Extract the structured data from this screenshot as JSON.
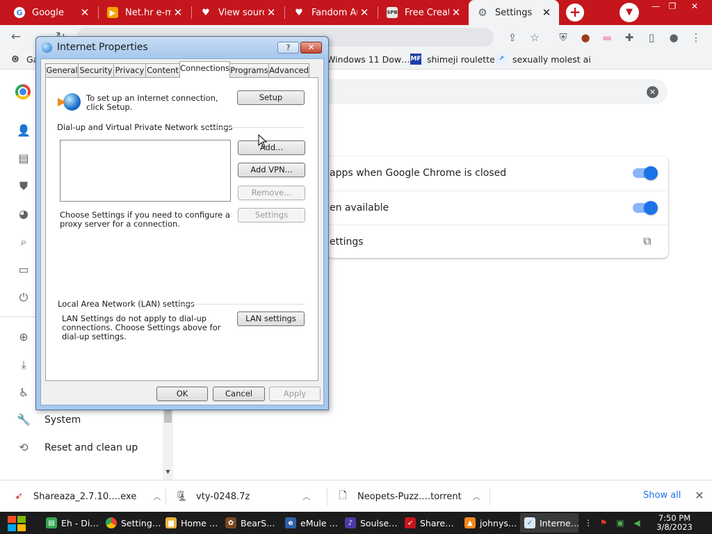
{
  "browser": {
    "tabs": [
      {
        "title": "Google",
        "icon": "google-icon"
      },
      {
        "title": "Net.hr e-mail",
        "icon": "play-icon"
      },
      {
        "title": "View source",
        "icon": "fandom-icon"
      },
      {
        "title": "Fandom Auth",
        "icon": "fandom-icon"
      },
      {
        "title": "Free Creation",
        "icon": "spb-icon"
      },
      {
        "title": "Settings",
        "icon": "gear-icon"
      }
    ],
    "bookmarks": [
      {
        "label": "Ga"
      },
      {
        "label": "Windows 11 Dow…"
      },
      {
        "label": "shimeji roulette"
      },
      {
        "label": "sexually molest ai"
      }
    ],
    "accent": "#c4161c"
  },
  "settings": {
    "sidebar": [
      {
        "label": "System"
      },
      {
        "label": "Reset and clean up"
      }
    ],
    "rows": [
      {
        "label": "apps when Google Chrome is closed"
      },
      {
        "label": "en available"
      },
      {
        "label": "ettings"
      }
    ]
  },
  "dialog": {
    "title": "Internet Properties",
    "help_label": "?",
    "close_label": "✕",
    "tabs": [
      "General",
      "Security",
      "Privacy",
      "Content",
      "Connections",
      "Programs",
      "Advanced"
    ],
    "active_tab": "Connections",
    "setup_text": "To set up an Internet connection, click Setup.",
    "setup_button": "Setup",
    "dialup_heading": "Dial-up and Virtual Private Network settings",
    "add_button": "Add...",
    "add_vpn_button": "Add VPN...",
    "remove_button": "Remove...",
    "settings_button": "Settings",
    "proxy_text": "Choose Settings if you need to configure a proxy server for a connection.",
    "lan_heading": "Local Area Network (LAN) settings",
    "lan_text": "LAN Settings do not apply to dial-up connections. Choose Settings above for dial-up settings.",
    "lan_button": "LAN settings",
    "ok_button": "OK",
    "cancel_button": "Cancel",
    "apply_button": "Apply"
  },
  "downloads": {
    "items": [
      {
        "name": "Shareaza_2.7.10….exe"
      },
      {
        "name": "vty-0248.7z"
      },
      {
        "name": "Neopets-Puzz….torrent"
      }
    ],
    "show_all": "Show all"
  },
  "taskbar": {
    "items": [
      {
        "label": "Eh - Di…"
      },
      {
        "label": "Setting…"
      },
      {
        "label": "Home …"
      },
      {
        "label": "BearS…"
      },
      {
        "label": "eMule …"
      },
      {
        "label": "Soulse…"
      },
      {
        "label": "Share…"
      },
      {
        "label": "johnys…"
      },
      {
        "label": "Interne…"
      }
    ],
    "time": "7:50 PM",
    "date": "3/8/2023"
  }
}
